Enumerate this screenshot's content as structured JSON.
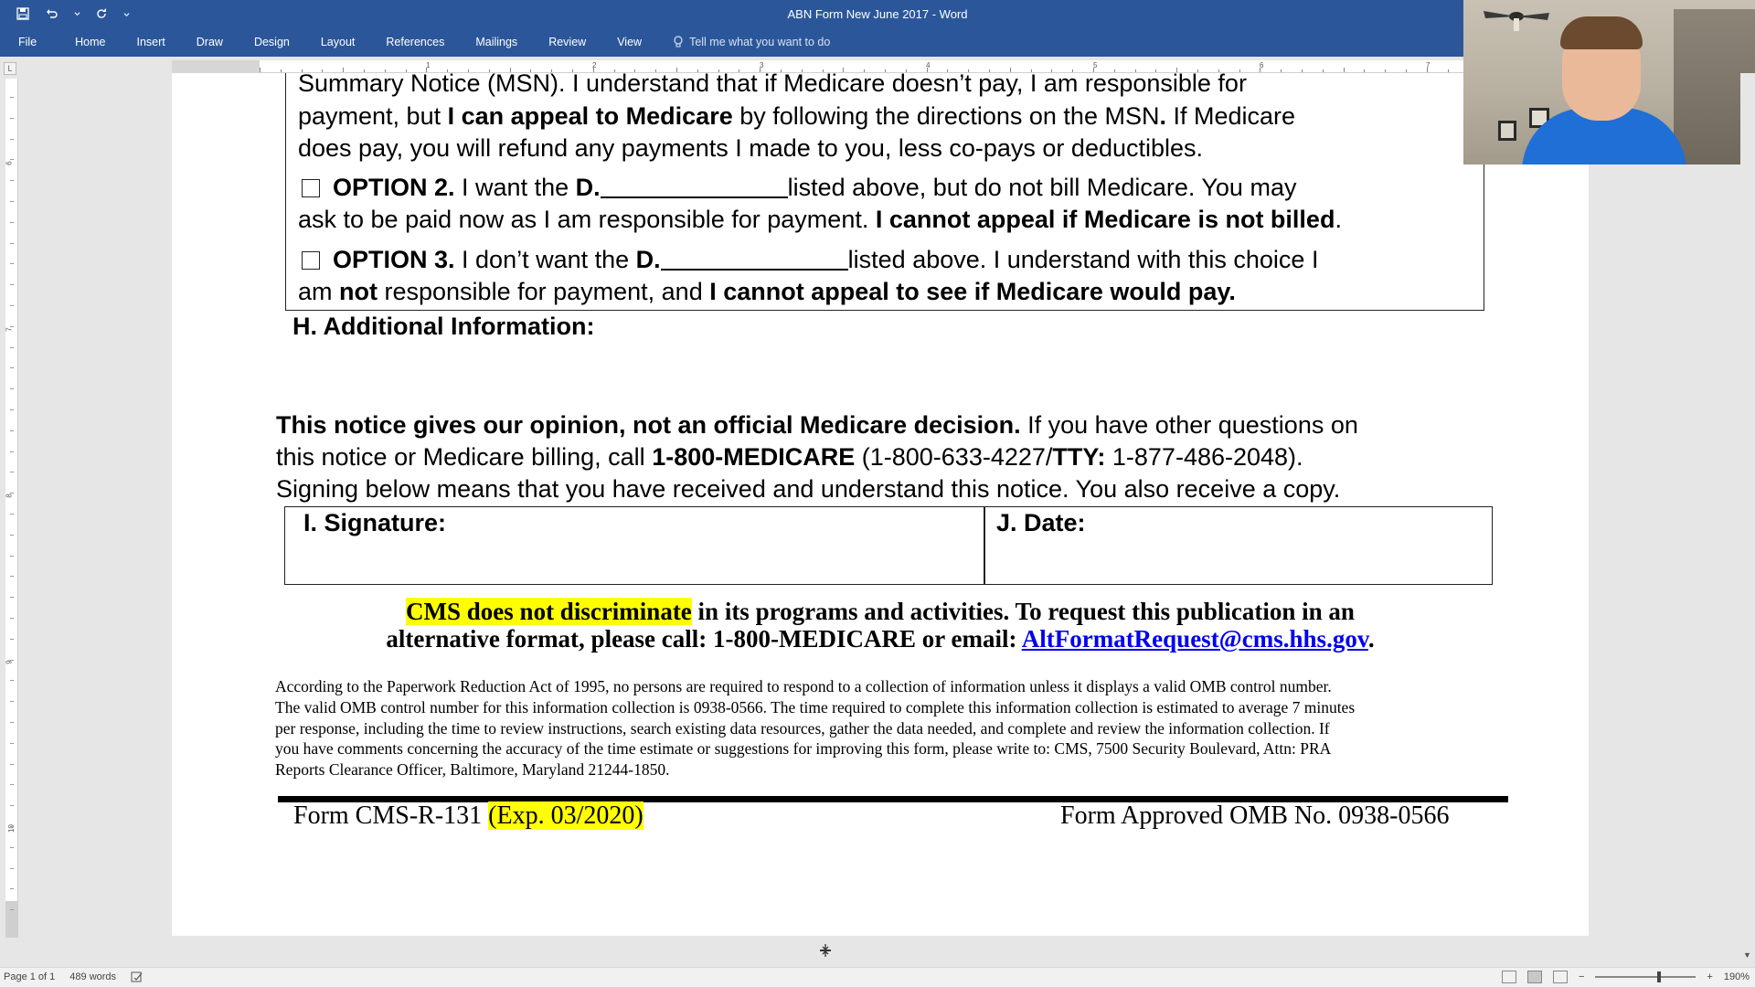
{
  "window": {
    "title": "ABN Form New June 2017  -  Word"
  },
  "ribbon": {
    "tabs": [
      "File",
      "Home",
      "Insert",
      "Draw",
      "Design",
      "Layout",
      "References",
      "Mailings",
      "Review",
      "View"
    ],
    "tell_me": "Tell me what you want to do"
  },
  "ruler": {
    "corner": "L",
    "h_numbers": [
      "1",
      "2",
      "3",
      "4",
      "5",
      "6",
      "7"
    ],
    "v_numbers": [
      "6",
      "7",
      "8",
      "9",
      "10"
    ]
  },
  "document": {
    "option1": {
      "line1": "Summary Notice (MSN). I understand that if Medicare doesn’t pay, I am responsible for",
      "line2_a": "payment, but ",
      "line2_b": "I can appeal to Medicare",
      "line2_c": " by following the directions on the MSN",
      "line2_d": ".",
      "line2_e": " If Medicare",
      "line3": "does pay, you will refund any payments I made to you, less co-pays or deductibles."
    },
    "option2": {
      "label": "OPTION 2.",
      "text_a": "  I want the   ",
      "d": "D.",
      "text_b": "listed above, but do not bill Medicare. You may",
      "line2_a": "ask to be paid now as I am responsible for payment. ",
      "line2_b": "I cannot appeal if Medicare is not billed",
      "line2_c": "."
    },
    "option3": {
      "label": "OPTION 3.",
      "text_a": " I don’t want the ",
      "d": "D.",
      "text_b": "listed above.  I understand with this choice I",
      "line2_a": "am ",
      "line2_b": "not",
      "line2_c": " responsible for payment, and ",
      "line2_d": "I cannot appeal to see if Medicare would pay."
    },
    "section_h": "H. Additional Information:",
    "notice": {
      "line1_bold": "This notice gives our opinion, not an official Medicare decision.",
      "line1_rest": " If you have other questions on",
      "line2_a": "this notice or Medicare billing, call ",
      "line2_b": "1-800-MEDICARE",
      "line2_c": " (1-800-633-4227/",
      "line2_d": "TTY:",
      "line2_e": " 1-877-486-2048).",
      "line3": "Signing below means that you have received and understand this notice. You also receive a copy."
    },
    "signature_label": "I. Signature:",
    "date_label": "J. Date:",
    "cms": {
      "highlight": "CMS does not discriminate",
      "line1_rest": " in its programs and activities. To request this publication in an",
      "line2_a": "alternative format, please call: 1-800-MEDICARE or email: ",
      "email": "AltFormatRequest@cms.hhs.gov",
      "line2_end": "."
    },
    "pra": [
      "According to the Paperwork Reduction Act of 1995, no persons are required to respond to a collection of information unless it displays a valid OMB control number.",
      "The valid OMB control number for this information collection is 0938-0566. The time required to complete this information collection is estimated to average 7 minutes",
      "per response, including the time to review instructions, search existing data resources, gather the data needed, and complete and review the information collection. If",
      "you have comments concerning the accuracy of the time estimate or suggestions for improving this form, please write to: CMS, 7500 Security Boulevard, Attn: PRA",
      "Reports Clearance Officer, Baltimore, Maryland 21244-1850."
    ],
    "footer_left_a": "Form CMS-R-131 ",
    "footer_left_exp": "(Exp. 03/2020)",
    "footer_right": "Form Approved OMB No. 0938-0566"
  },
  "status": {
    "page": "Page 1 of 1",
    "words": "489 words",
    "zoom": "190%",
    "zoom_minus": "−",
    "zoom_plus": "+"
  },
  "colors": {
    "ribbon": "#2b579a",
    "highlight": "#ffff00",
    "link": "#0000ee"
  }
}
